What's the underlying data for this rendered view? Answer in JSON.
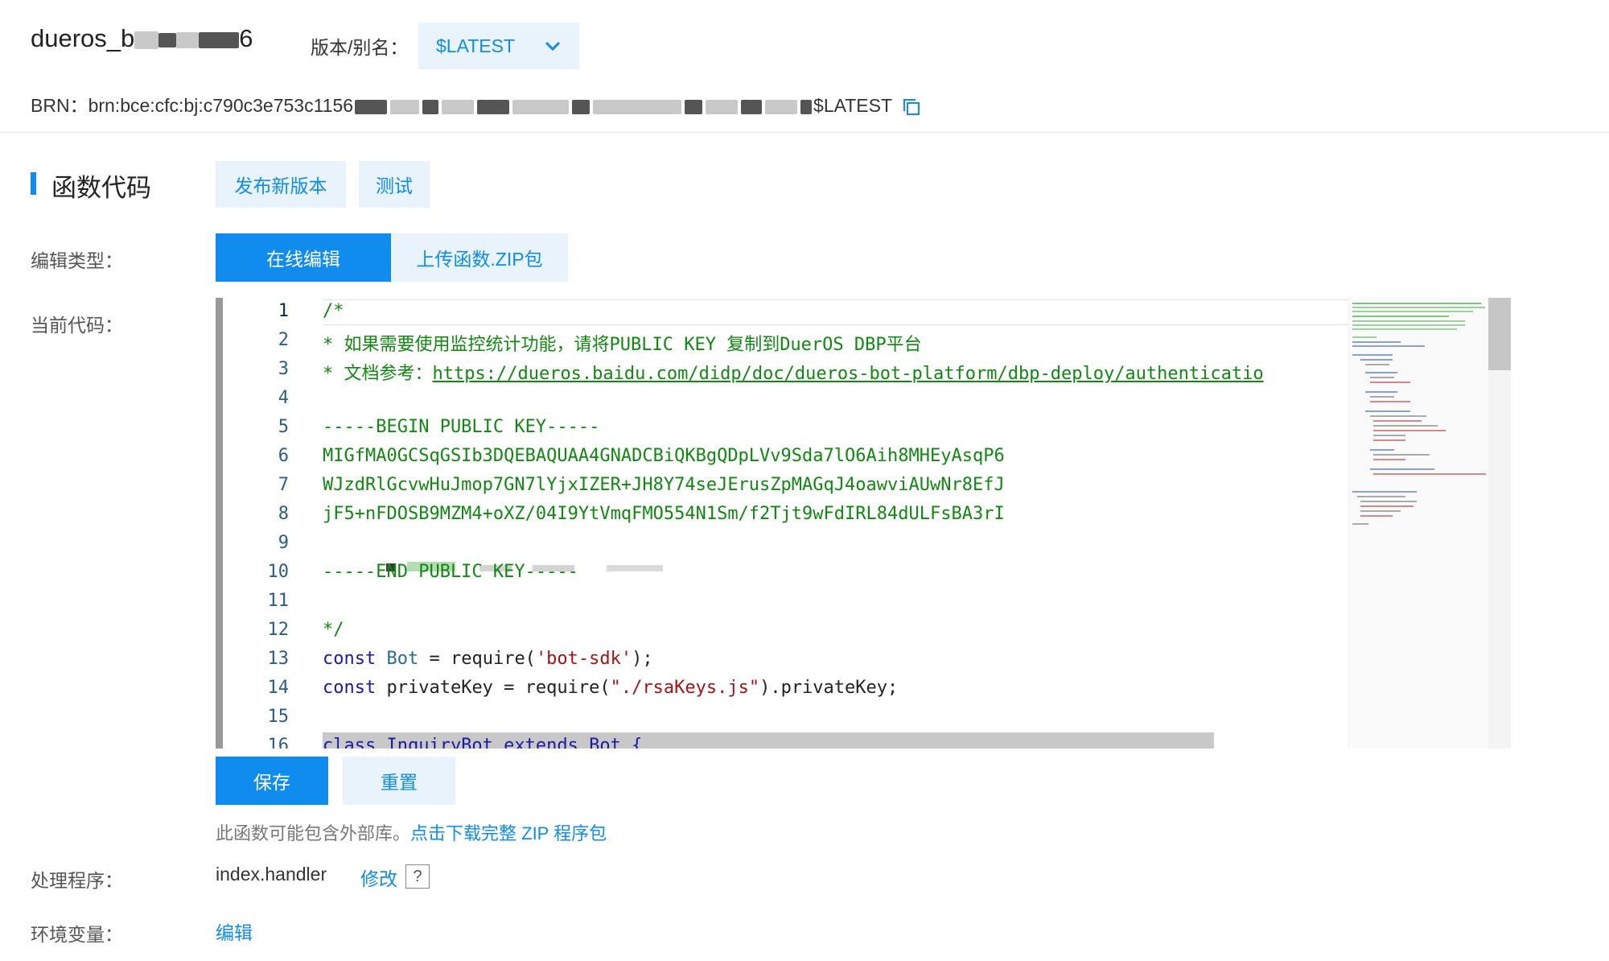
{
  "header": {
    "function_name_visible": "dueros_b",
    "function_name_tail": "6",
    "alias_label": "版本/别名：",
    "alias_value": "$LATEST",
    "brn_label": "BRN：",
    "brn_prefix": "brn:bce:cfc:bj:c790c3e753c1156",
    "brn_suffix": "$LATEST"
  },
  "section": {
    "title": "函数代码",
    "publish_button": "发布新版本",
    "test_button": "测试"
  },
  "edit_type": {
    "label": "编辑类型：",
    "tabs": [
      "在线编辑",
      "上传函数.ZIP包"
    ],
    "active_tab": "在线编辑"
  },
  "code": {
    "label": "当前代码：",
    "line_numbers": [
      "1",
      "2",
      "3",
      "4",
      "5",
      "6",
      "7",
      "8",
      "9",
      "10",
      "11",
      "12",
      "13",
      "14",
      "15",
      "16"
    ],
    "lines": {
      "l1": "/*",
      "l2": "* 如果需要使用监控统计功能，请将PUBLIC KEY 复制到DuerOS DBP平台",
      "l3_prefix": "* 文档参考：",
      "l3_link": "https://dueros.baidu.com/didp/doc/dueros-bot-platform/dbp-deploy/authenticatio",
      "l5": "-----BEGIN PUBLIC KEY-----",
      "l6": "MIGfMA0GCSqGSIb3DQEBAQUAA4GNADCBiQKBgQDpLVv9Sda7lO6Aih8MHEyAsqP6",
      "l7": "WJzdRlGcvwHuJmop7GN7lYjxIZER+JH8Y74seJErusZpMAGqJ4oawviAUwNr8EfJ",
      "l8": "jF5+nFDOSB9MZM4+oXZ/04I9YtVmqFMO554N1Sm/f2Tjt9wFdIRL84dULFsBA3rI",
      "l10": "-----END PUBLIC KEY-----",
      "l12": "*/",
      "l13_kw": "const",
      "l13_name": "Bot",
      "l13_mid": " = require(",
      "l13_str": "'bot-sdk'",
      "l13_end": ");",
      "l14_kw": "const",
      "l14_mid": " privateKey = require(",
      "l14_str": "\"./rsaKeys.js\"",
      "l14_end": ").privateKey;",
      "l16": "class InquiryBot extends Bot {"
    }
  },
  "actions": {
    "save": "保存",
    "reset": "重置",
    "zip_note": "此函数可能包含外部库。",
    "zip_link": "点击下载完整 ZIP 程序包"
  },
  "handler": {
    "label": "处理程序：",
    "value": "index.handler",
    "edit": "修改",
    "help": "?"
  },
  "env": {
    "label": "环境变量：",
    "edit": "编辑"
  },
  "colors": {
    "accent": "#108cee",
    "light_button_bg": "#e9f3fc",
    "comment_green": "#118811"
  }
}
